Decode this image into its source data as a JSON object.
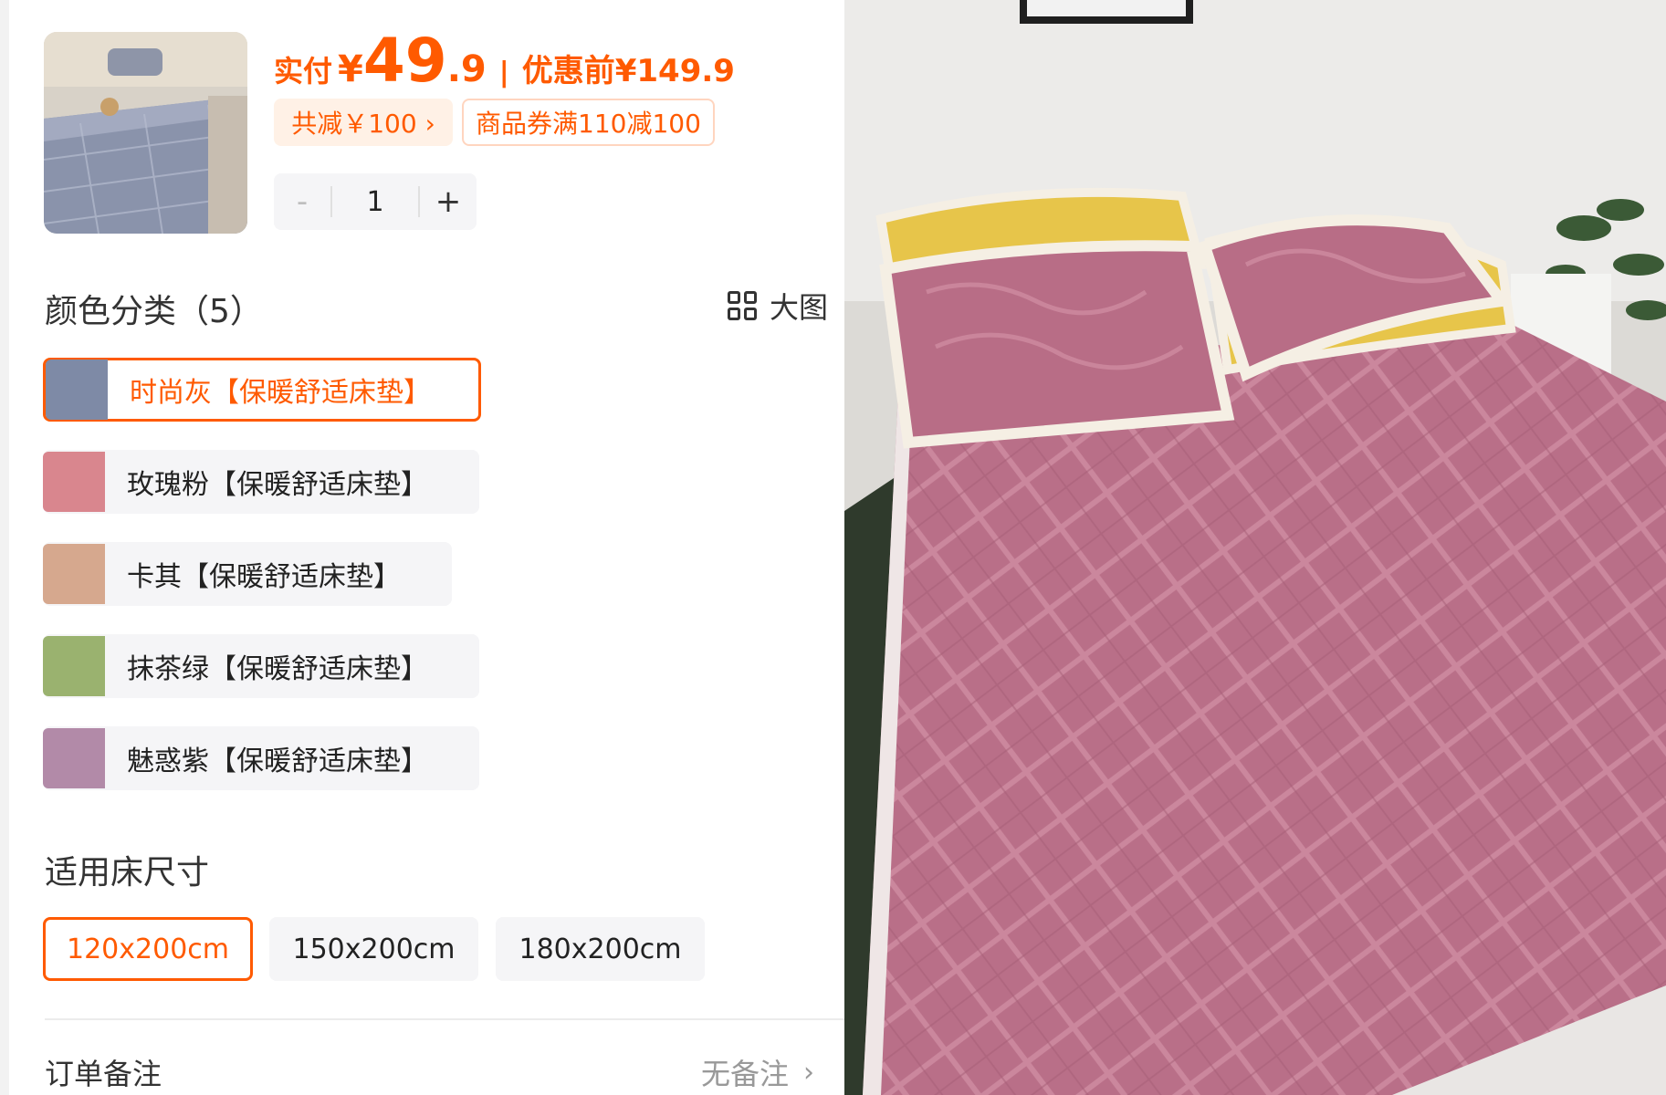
{
  "product": {
    "thumbnail_icon": "product-thumbnail-grey-mattress",
    "price_label": "实付",
    "currency": "¥",
    "price_int": "49",
    "price_dec": ".9",
    "separator": "|",
    "before_label": "优惠前¥149.9",
    "discount_chip": "共减￥100 ›",
    "coupon_chip": "商品券满110减100",
    "accent_color": "#ff5a00"
  },
  "quantity": {
    "minus_label": "-",
    "value": "1",
    "plus_label": "+"
  },
  "color_section": {
    "title": "颜色分类（5）",
    "big_view_label": "大图",
    "options": [
      {
        "label": "时尚灰【保暖舒适床垫】",
        "selected": true,
        "swatch": "#7e8aa6"
      },
      {
        "label": "玫瑰粉【保暖舒适床垫】",
        "selected": false,
        "swatch": "#d9868e"
      },
      {
        "label": "卡其【保暖舒适床垫】",
        "selected": false,
        "swatch": "#d6a88e"
      },
      {
        "label": "抹茶绿【保暖舒适床垫】",
        "selected": false,
        "swatch": "#9ab26f"
      },
      {
        "label": "魅惑紫【保暖舒适床垫】",
        "selected": false,
        "swatch": "#b28aa8"
      }
    ]
  },
  "size_section": {
    "title": "适用床尺寸",
    "options": [
      {
        "label": "120x200cm",
        "selected": true
      },
      {
        "label": "150x200cm",
        "selected": false
      },
      {
        "label": "180x200cm",
        "selected": false
      }
    ]
  },
  "order_notes": {
    "label": "订单备注",
    "value": "无备注",
    "chevron": "›"
  },
  "preview": {
    "image_icon": "large-product-photo-pink-mattress"
  }
}
